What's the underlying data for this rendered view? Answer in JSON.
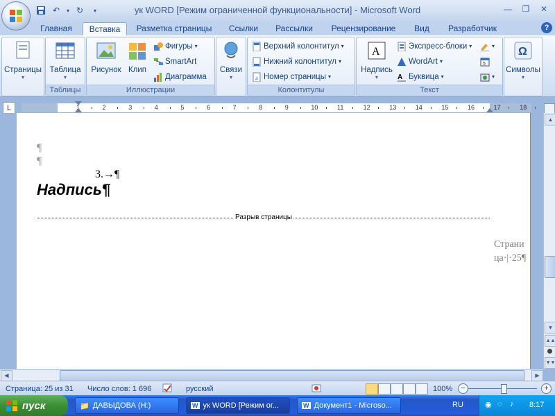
{
  "window": {
    "title": "ук WORD [Режим ограниченной функциональности] - Microsoft Word"
  },
  "tabs": [
    {
      "label": "Главная"
    },
    {
      "label": "Вставка",
      "active": true
    },
    {
      "label": "Разметка страницы"
    },
    {
      "label": "Ссылки"
    },
    {
      "label": "Рассылки"
    },
    {
      "label": "Рецензирование"
    },
    {
      "label": "Вид"
    },
    {
      "label": "Разработчик"
    }
  ],
  "ribbon": {
    "pages": {
      "label": "Страницы"
    },
    "tables": {
      "button": "Таблица",
      "group": "Таблицы"
    },
    "illustrations": {
      "picture": "Рисунок",
      "clip": "Клип",
      "shapes": "Фигуры",
      "smartart": "SmartArt",
      "chart": "Диаграмма",
      "group": "Иллюстрации"
    },
    "links": {
      "button": "Связи"
    },
    "headerfooter": {
      "header": "Верхний колонтитул",
      "footer": "Нижний колонтитул",
      "pagenumber": "Номер страницы",
      "group": "Колонтитулы"
    },
    "text": {
      "textbox": "Надпись",
      "quickparts": "Экспресс-блоки",
      "wordart": "WordArt",
      "dropcap": "Буквица",
      "group": "Текст"
    },
    "symbols": {
      "button": "Символы"
    }
  },
  "ruler": {
    "corner": "L",
    "numbers": [
      "1",
      "2",
      "3",
      "4",
      "5",
      "6",
      "7",
      "8",
      "9",
      "10",
      "11",
      "12",
      "13",
      "14",
      "15",
      "16",
      "17",
      "18"
    ]
  },
  "document": {
    "pilcrow": "¶",
    "item_number": "3.→¶",
    "heading": "Надпись¶",
    "page_break_label": "Разрыв страницы",
    "margin_note_line1": "Страни",
    "margin_note_line2": "ца·|·25¶"
  },
  "statusbar": {
    "page": "Страница: 25 из 31",
    "words": "Число слов: 1 696",
    "language": "русский",
    "zoom": "100%"
  },
  "taskbar": {
    "start": "пуск",
    "tasks": [
      {
        "label": "ДАВЫДОВА (H:)"
      },
      {
        "label": "ук WORD [Режим ог...",
        "active": true
      },
      {
        "label": "Документ1 - Microso..."
      }
    ],
    "lang": "RU",
    "time": "8:17"
  },
  "colors": {
    "accent": "#15428b",
    "ribbon_bg": "#dbe7f7",
    "taskbar": "#245edc",
    "start": "#3a8f35"
  }
}
